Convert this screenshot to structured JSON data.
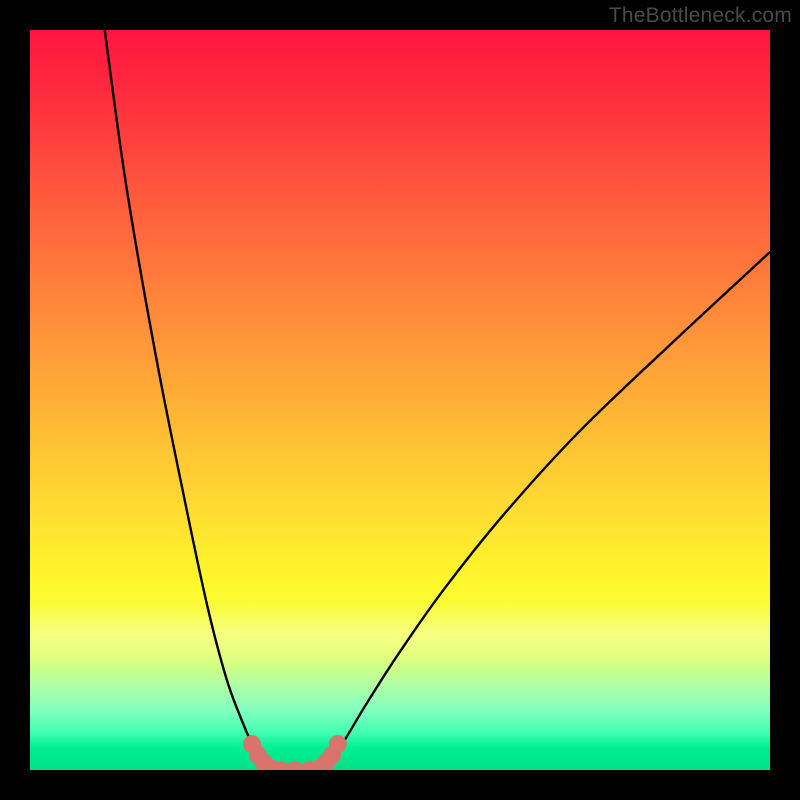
{
  "watermark": "TheBottleneck.com",
  "chart_data": {
    "type": "line",
    "title": "",
    "xlabel": "",
    "ylabel": "",
    "xlim": [
      0,
      100
    ],
    "ylim": [
      0,
      100
    ],
    "grid": false,
    "legend": false,
    "background_gradient": {
      "top_color": "#ff153f",
      "bottom_color": "#00e088",
      "stops": [
        "red",
        "orange",
        "yellow",
        "green"
      ]
    },
    "series": [
      {
        "name": "left-branch",
        "x": [
          10.1,
          13,
          17,
          21,
          24,
          26.5,
          28.5,
          30,
          31.2,
          32.3
        ],
        "y": [
          100,
          79,
          56,
          36,
          22,
          12.5,
          7,
          3.5,
          1.3,
          0.2
        ],
        "stroke": "#000000",
        "stroke_width": 2.4
      },
      {
        "name": "right-branch",
        "x": [
          39.5,
          40.7,
          42.5,
          45.5,
          50,
          56,
          64,
          74,
          86,
          100
        ],
        "y": [
          0.2,
          1.3,
          4,
          9,
          16,
          24.5,
          34.5,
          45.5,
          57,
          70
        ],
        "stroke": "#000000",
        "stroke_width": 2.4
      },
      {
        "name": "valley-floor",
        "x": [
          32.6,
          33.3,
          34.3,
          35.8,
          37.3,
          38.5,
          39.2
        ],
        "y": [
          0,
          0,
          0,
          0,
          0,
          0,
          0
        ],
        "stroke": "#000000",
        "stroke_width": 2.4
      },
      {
        "name": "valley-markers",
        "type_override": "scatter",
        "x": [
          30.0,
          30.8,
          31.6,
          32.6,
          33.8,
          35.8,
          37.8,
          39.0,
          40.0,
          40.8,
          41.6
        ],
        "y": [
          3.5,
          2.0,
          1.0,
          0.2,
          0.0,
          0.0,
          0.0,
          0.2,
          1.0,
          2.0,
          3.5
        ],
        "marker_color": "#d9736e",
        "marker_radius_px": 9
      }
    ]
  }
}
